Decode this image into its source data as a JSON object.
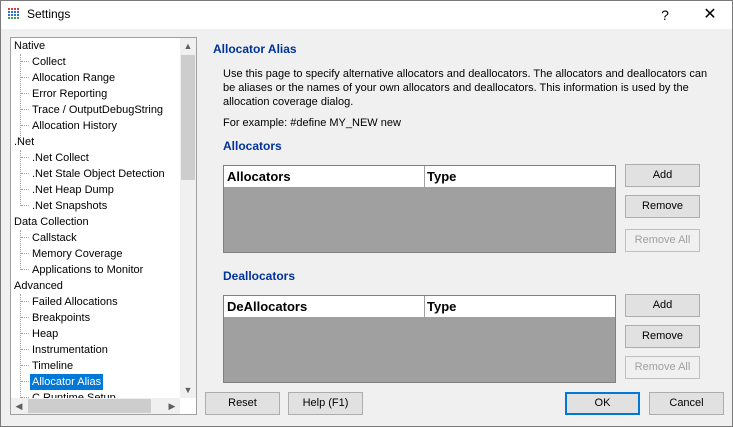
{
  "window": {
    "title": "Settings",
    "help": "?",
    "close": "✕"
  },
  "tree": {
    "items": [
      {
        "label": "Native",
        "level": 0
      },
      {
        "label": "Collect",
        "level": 1
      },
      {
        "label": "Allocation Range",
        "level": 1
      },
      {
        "label": "Error Reporting",
        "level": 1
      },
      {
        "label": "Trace / OutputDebugString",
        "level": 1
      },
      {
        "label": "Allocation History",
        "level": 1
      },
      {
        "label": ".Net",
        "level": 0
      },
      {
        "label": ".Net Collect",
        "level": 1
      },
      {
        "label": ".Net Stale Object Detection",
        "level": 1
      },
      {
        "label": ".Net Heap Dump",
        "level": 1
      },
      {
        "label": ".Net Snapshots",
        "level": 1
      },
      {
        "label": "Data Collection",
        "level": 0
      },
      {
        "label": "Callstack",
        "level": 1
      },
      {
        "label": "Memory Coverage",
        "level": 1
      },
      {
        "label": "Applications to Monitor",
        "level": 1
      },
      {
        "label": "Advanced",
        "level": 0
      },
      {
        "label": "Failed Allocations",
        "level": 1
      },
      {
        "label": "Breakpoints",
        "level": 1
      },
      {
        "label": "Heap",
        "level": 1
      },
      {
        "label": "Instrumentation",
        "level": 1
      },
      {
        "label": "Timeline",
        "level": 1
      },
      {
        "label": "Allocator Alias",
        "level": 1,
        "selected": true
      },
      {
        "label": "C Runtime Setup",
        "level": 1
      }
    ]
  },
  "page": {
    "title": "Allocator Alias",
    "description": "Use this page to specify alternative allocators and deallocators. The allocators and deallocators can be aliases or the names of your own allocators and deallocators. This information is used by the allocation coverage dialog.",
    "example": "For example: #define MY_NEW new"
  },
  "allocators": {
    "heading": "Allocators",
    "columns": [
      "Allocators",
      "Type"
    ],
    "add": "Add",
    "remove": "Remove",
    "remove_all": "Remove All"
  },
  "deallocators": {
    "heading": "Deallocators",
    "columns": [
      "DeAllocators",
      "Type"
    ],
    "add": "Add",
    "remove": "Remove",
    "remove_all": "Remove All"
  },
  "footer": {
    "reset": "Reset",
    "help": "Help (F1)",
    "ok": "OK",
    "cancel": "Cancel"
  }
}
